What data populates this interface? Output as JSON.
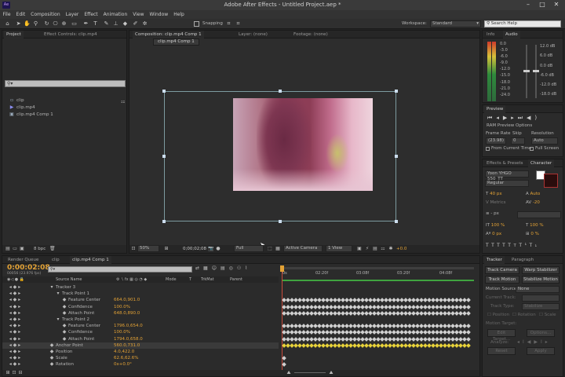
{
  "app": {
    "title": "Adobe After Effects - Untitled Project.aep *",
    "icon": "Ae"
  },
  "menu": [
    "File",
    "Edit",
    "Composition",
    "Layer",
    "Effect",
    "Animation",
    "View",
    "Window",
    "Help"
  ],
  "toolbar": {
    "snapping_label": "Snapping",
    "workspace_label": "Workspace:",
    "workspace_value": "Standard",
    "search_placeholder": "Search Help"
  },
  "project_panel": {
    "tabs": [
      "Project",
      "Effect Controls: clip.mp4"
    ],
    "items": [
      {
        "name": "clip",
        "icon": "folder-icon"
      },
      {
        "name": "clip.mp4",
        "icon": "film-icon"
      },
      {
        "name": "clip.mp4 Comp 1",
        "icon": "composition-icon"
      }
    ],
    "bpc": "8 bpc"
  },
  "comp_panel": {
    "tabs": [
      "Composition: clip.mp4 Comp 1",
      "Layer: (none)",
      "Footage: (none)"
    ],
    "subtab": "clip.mp4 Comp 1",
    "zoom": "50%",
    "timecode": "0;00;02;08",
    "resolution": "Full",
    "camera": "Active Camera",
    "views": "1 View",
    "exposure": "+0.0"
  },
  "info_panel": {
    "tabs": [
      "Info",
      "Audio"
    ],
    "db_labels": [
      "0.0",
      "-3.0",
      "-6.0",
      "-9.0",
      "-12.0",
      "-15.0",
      "-18.0",
      "-21.0",
      "-24.0"
    ],
    "db_labels_right": [
      "12.0 dB",
      "6.0 dB",
      "0.0 dB",
      "-6.0 dB",
      "-12.0 dB",
      "-18.0 dB"
    ]
  },
  "preview_panel": {
    "tab": "Preview",
    "ram_preview": "RAM Preview Options",
    "frame_rate_label": "Frame Rate",
    "skip_label": "Skip",
    "resolution_label": "Resolution",
    "frame_rate": "(23.98)",
    "skip": "0",
    "resolution": "Auto",
    "from_current": "From Current Time",
    "full_screen": "Full Screen"
  },
  "effects_panel": {
    "tabs": [
      "Effects & Presets",
      "Character"
    ],
    "font": "Yoon YHGO 550_TT",
    "style": "Regular",
    "size": "40 px",
    "leading": "Auto",
    "tracking_label": "Metrics",
    "tracking": "-20",
    "stroke_unit": "- px",
    "scale_v": "100 %",
    "scale_h": "100 %",
    "baseline": "0 px",
    "tsume": "0 %",
    "stroke_option": "None"
  },
  "timeline": {
    "tabs": [
      "Render Queue",
      "clip",
      "clip.mp4 Comp 1"
    ],
    "timecode": "0:00:02:08",
    "timecode_sub": "00056 (23.976 fps)",
    "search_placeholder": "",
    "columns": [
      "Source Name",
      "Mode",
      "T",
      "TrkMat",
      "Parent"
    ],
    "ruler": [
      "0s",
      "02:20f",
      "03:08f",
      "03:20f",
      "04:08f"
    ],
    "rows": [
      {
        "indent": 1,
        "label": "Tracker 3",
        "value": ""
      },
      {
        "indent": 2,
        "label": "Track Point 1",
        "value": ""
      },
      {
        "indent": 3,
        "label": "Feature Center",
        "value": "664.0,901.0"
      },
      {
        "indent": 3,
        "label": "Confidence",
        "value": "100.0%"
      },
      {
        "indent": 3,
        "label": "Attach Point",
        "value": "648.0,890.0"
      },
      {
        "indent": 2,
        "label": "Track Point 2",
        "value": ""
      },
      {
        "indent": 3,
        "label": "Feature Center",
        "value": "1796.0,654.0"
      },
      {
        "indent": 3,
        "label": "Confidence",
        "value": "100.0%"
      },
      {
        "indent": 3,
        "label": "Attach Point",
        "value": "1794.0,658.0"
      },
      {
        "indent": 1,
        "label": "Anchor Point",
        "value": "560.0,731.0"
      },
      {
        "indent": 1,
        "label": "Position",
        "value": "4.0,422.0"
      },
      {
        "indent": 1,
        "label": "Scale",
        "value": "62.6,62.6%"
      },
      {
        "indent": 1,
        "label": "Rotation",
        "value": "0x+0.0°"
      }
    ],
    "toggle_label": "Toggle Switches / Modes"
  },
  "tracker_panel": {
    "tabs": [
      "Tracker",
      "Paragraph"
    ],
    "buttons": [
      "Track Camera",
      "Warp Stabilizer",
      "Track Motion",
      "Stabilize Motion"
    ],
    "motion_source_label": "Motion Source:",
    "motion_source": "None",
    "current_track_label": "Current Track:",
    "track_type_label": "Track Type:",
    "track_type": "Stabilize",
    "position_label": "Position",
    "rotation_label": "Rotation",
    "scale_label": "Scale",
    "motion_target_label": "Motion Target:",
    "edit_target": "Edit Target...",
    "options": "Options...",
    "analyze_label": "Analyze:",
    "reset": "Reset",
    "apply": "Apply"
  },
  "colors": {
    "accent": "#e3a235",
    "timeline_green": "#3fa33f",
    "keyframe": "#cfcfcf",
    "playhead": "#c84a3a"
  }
}
